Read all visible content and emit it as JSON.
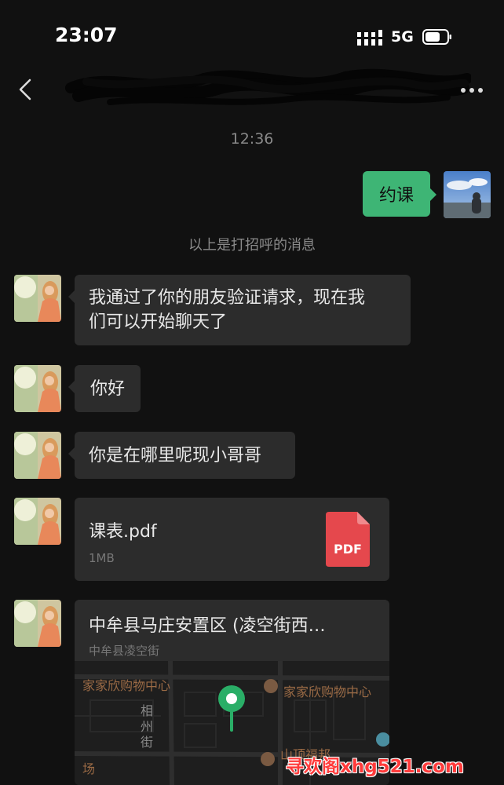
{
  "status_bar": {
    "time": "23:07",
    "network": "5G"
  },
  "header": {
    "title": ""
  },
  "chat": {
    "timestamp": "12:36",
    "system_notice": "以上是打招呼的消息",
    "sent": [
      {
        "text": "约课"
      }
    ],
    "received": [
      {
        "text_line1": "我通过了你的朋友验证请求，现在我",
        "text_line2": "们可以开始聊天了"
      },
      {
        "text": "你好"
      },
      {
        "text": "你是在哪里呢现小哥哥"
      }
    ],
    "file": {
      "name": "课表.pdf",
      "size": "1MB",
      "icon_label": "PDF",
      "icon_color": "#e5484d"
    },
    "location": {
      "title": "中牟县马庄安置区 (凌空街西…",
      "subtitle": "中牟县凌空街",
      "map_labels": {
        "poi_left": "家家欣购物中心",
        "poi_right": "家家欣购物中心",
        "street": "相州街",
        "edge_left": "场",
        "edge_bottom": "山顶福邦"
      }
    }
  },
  "colors": {
    "sent_bubble": "#3eb575",
    "received_bubble": "#2c2c2c",
    "background": "#111111",
    "map_pin": "#2aae67"
  },
  "watermark": "寻欢阁xhg521.com"
}
